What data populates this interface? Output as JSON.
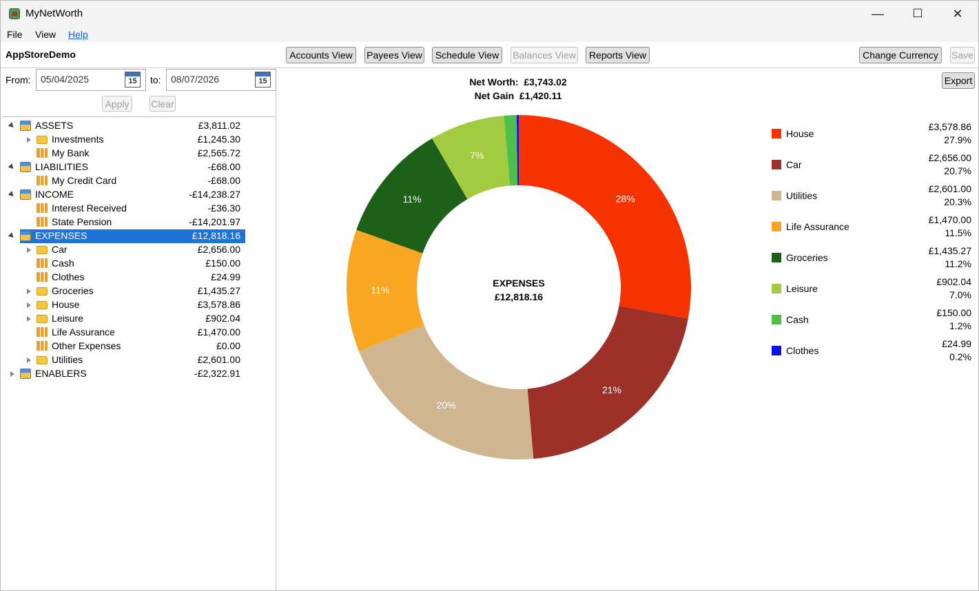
{
  "window": {
    "title": "MyNetWorth",
    "minimize": "—",
    "maximize": "☐",
    "close": "✕"
  },
  "menu": {
    "file": "File",
    "view": "View",
    "help": "Help"
  },
  "toolbar": {
    "profile": "AppStoreDemo",
    "accounts_view": "Accounts View",
    "payees_view": "Payees View",
    "schedule_view": "Schedule View",
    "balances_view": "Balances View",
    "reports_view": "Reports View",
    "change_currency": "Change Currency",
    "save": "Save"
  },
  "filter": {
    "from_label": "From:",
    "from_value": "05/04/2025",
    "to_label": "to:",
    "to_value": "08/07/2026",
    "calendar_day": "15",
    "apply": "Apply",
    "clear": "Clear"
  },
  "tree": [
    {
      "name": "ASSETS",
      "amount": "£3,811.02",
      "level": 0,
      "icon": "account-icon",
      "expander": "open"
    },
    {
      "name": "Investments",
      "amount": "£1,245.30",
      "level": 1,
      "icon": "folder-icon",
      "expander": "closed"
    },
    {
      "name": "My Bank",
      "amount": "£2,565.72",
      "level": 1,
      "icon": "category-icon",
      "expander": "none"
    },
    {
      "name": "LIABILITIES",
      "amount": "-£68.00",
      "level": 0,
      "icon": "account-icon",
      "expander": "open"
    },
    {
      "name": "My Credit Card",
      "amount": "-£68.00",
      "level": 1,
      "icon": "category-icon",
      "expander": "none"
    },
    {
      "name": "INCOME",
      "amount": "-£14,238.27",
      "level": 0,
      "icon": "account-icon",
      "expander": "open"
    },
    {
      "name": "Interest Received",
      "amount": "-£36.30",
      "level": 1,
      "icon": "category-icon",
      "expander": "none"
    },
    {
      "name": "State Pension",
      "amount": "-£14,201.97",
      "level": 1,
      "icon": "category-icon",
      "expander": "none"
    },
    {
      "name": "EXPENSES",
      "amount": "£12,818.16",
      "level": 0,
      "icon": "account-icon",
      "expander": "open",
      "selected": true
    },
    {
      "name": "Car",
      "amount": "£2,656.00",
      "level": 1,
      "icon": "folder-icon",
      "expander": "closed"
    },
    {
      "name": "Cash",
      "amount": "£150.00",
      "level": 1,
      "icon": "category-icon",
      "expander": "none"
    },
    {
      "name": "Clothes",
      "amount": "£24.99",
      "level": 1,
      "icon": "category-icon",
      "expander": "none"
    },
    {
      "name": "Groceries",
      "amount": "£1,435.27",
      "level": 1,
      "icon": "folder-icon",
      "expander": "closed"
    },
    {
      "name": "House",
      "amount": "£3,578.86",
      "level": 1,
      "icon": "folder-icon",
      "expander": "closed"
    },
    {
      "name": "Leisure",
      "amount": "£902.04",
      "level": 1,
      "icon": "folder-icon",
      "expander": "closed"
    },
    {
      "name": "Life Assurance",
      "amount": "£1,470.00",
      "level": 1,
      "icon": "category-icon",
      "expander": "none"
    },
    {
      "name": "Other Expenses",
      "amount": "£0.00",
      "level": 1,
      "icon": "category-icon",
      "expander": "none"
    },
    {
      "name": "Utilities",
      "amount": "£2,601.00",
      "level": 1,
      "icon": "folder-icon",
      "expander": "closed"
    },
    {
      "name": "ENABLERS",
      "amount": "-£2,322.91",
      "level": 0,
      "icon": "account-icon",
      "expander": "closed"
    }
  ],
  "summary": {
    "net_worth_label": "Net Worth:",
    "net_worth_value": "£3,743.02",
    "net_gain_label": "Net Gain",
    "net_gain_value": "£1,420.11",
    "export": "Export"
  },
  "chart_data": {
    "type": "pie",
    "donut": true,
    "center_title": "EXPENSES",
    "center_value": "£12,818.16",
    "legend_position": "right",
    "slices": [
      {
        "name": "House",
        "value": 3578.86,
        "amount": "£3,578.86",
        "percent": "27.9%",
        "label": "28%",
        "color": "#f53200"
      },
      {
        "name": "Car",
        "value": 2656.0,
        "amount": "£2,656.00",
        "percent": "20.7%",
        "label": "21%",
        "color": "#9e302a"
      },
      {
        "name": "Utilities",
        "value": 2601.0,
        "amount": "£2,601.00",
        "percent": "20.3%",
        "label": "20%",
        "color": "#d0b690"
      },
      {
        "name": "Life Assurance",
        "value": 1470.0,
        "amount": "£1,470.00",
        "percent": "11.5%",
        "label": "11%",
        "color": "#f8a623"
      },
      {
        "name": "Groceries",
        "value": 1435.27,
        "amount": "£1,435.27",
        "percent": "11.2%",
        "label": "11%",
        "color": "#1e6018"
      },
      {
        "name": "Leisure",
        "value": 902.04,
        "amount": "£902.04",
        "percent": "7.0%",
        "label": "7%",
        "color": "#a2cb42"
      },
      {
        "name": "Cash",
        "value": 150.0,
        "amount": "£150.00",
        "percent": "1.2%",
        "label": "",
        "color": "#4cc04a"
      },
      {
        "name": "Clothes",
        "value": 24.99,
        "amount": "£24.99",
        "percent": "0.2%",
        "label": "",
        "color": "#1010e6"
      }
    ]
  }
}
